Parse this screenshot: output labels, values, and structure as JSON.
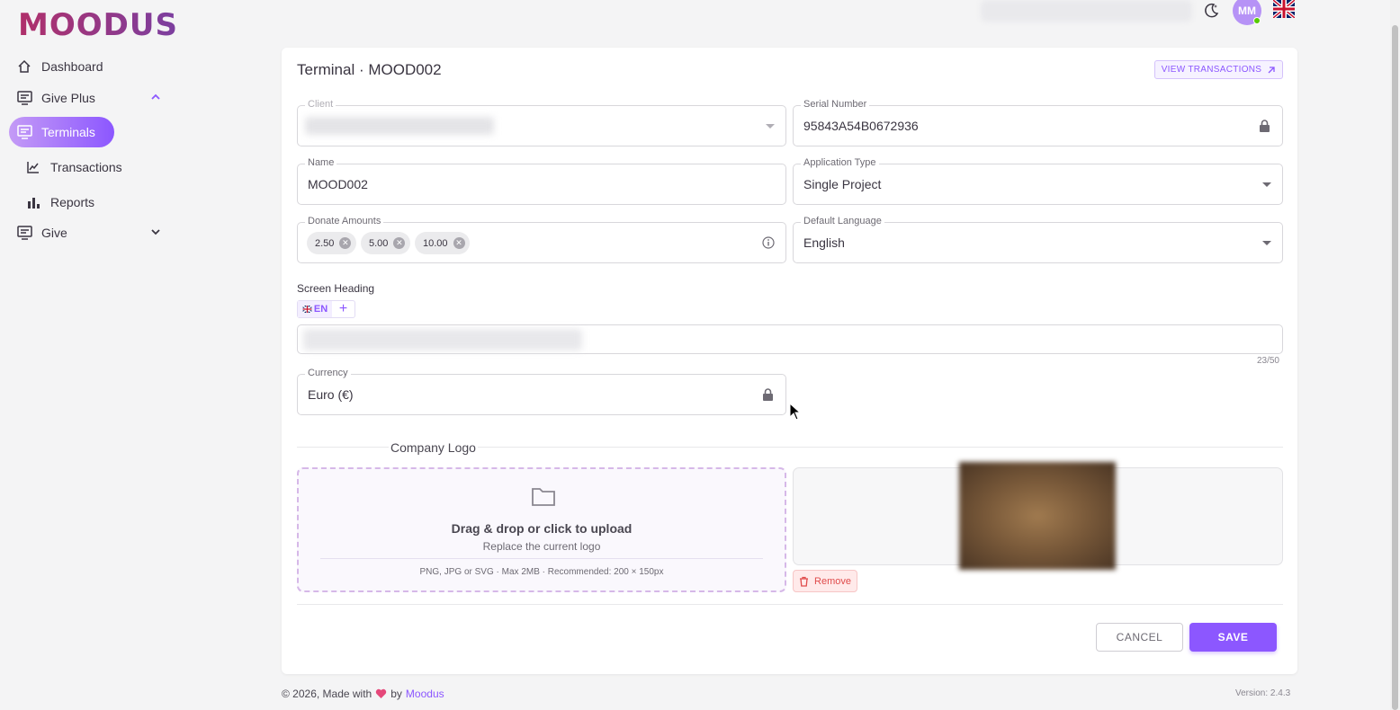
{
  "brand": {
    "logo_text": "MOODUS",
    "accent": "#8c57ff"
  },
  "sidebar": {
    "items": [
      {
        "label": "Dashboard",
        "icon": "home-icon"
      },
      {
        "label": "Give Plus",
        "icon": "terminal-icon"
      },
      {
        "label": "Terminals",
        "icon": "terminal-icon"
      },
      {
        "label": "Transactions",
        "icon": "chart-line-icon"
      },
      {
        "label": "Reports",
        "icon": "bar-chart-icon"
      },
      {
        "label": "Give",
        "icon": "terminal-icon"
      }
    ]
  },
  "header": {
    "avatar_initials": "MM"
  },
  "card": {
    "title": "Terminal · MOOD002",
    "view_transactions": "VIEW TRANSACTIONS"
  },
  "form": {
    "client_label": "Client",
    "serial_label": "Serial Number",
    "serial_value": "95843A54B0672936",
    "name_label": "Name",
    "name_value": "MOOD002",
    "app_type_label": "Application Type",
    "app_type_value": "Single Project",
    "donate_label": "Donate Amounts",
    "donate_amounts": [
      "2.50",
      "5.00",
      "10.00"
    ],
    "language_label": "Default Language",
    "language_value": "English",
    "screen_heading_label": "Screen Heading",
    "lang_tab": "EN",
    "lang_add": "+",
    "heading_counter": "23/50",
    "currency_label": "Currency",
    "currency_value": "Euro (€)"
  },
  "logo_section": {
    "label": "Company Logo",
    "drop_title": "Drag & drop or click to upload",
    "drop_subtitle": "Replace the current logo",
    "drop_hint": "PNG, JPG or SVG · Max 2MB · Recommended: 200 × 150px",
    "remove_label": "Remove"
  },
  "actions": {
    "cancel": "CANCEL",
    "save": "SAVE"
  },
  "footer": {
    "copyright": "© 2026, Made with",
    "by": "by",
    "brand": "Moodus",
    "version": "Version: 2.4.3"
  }
}
